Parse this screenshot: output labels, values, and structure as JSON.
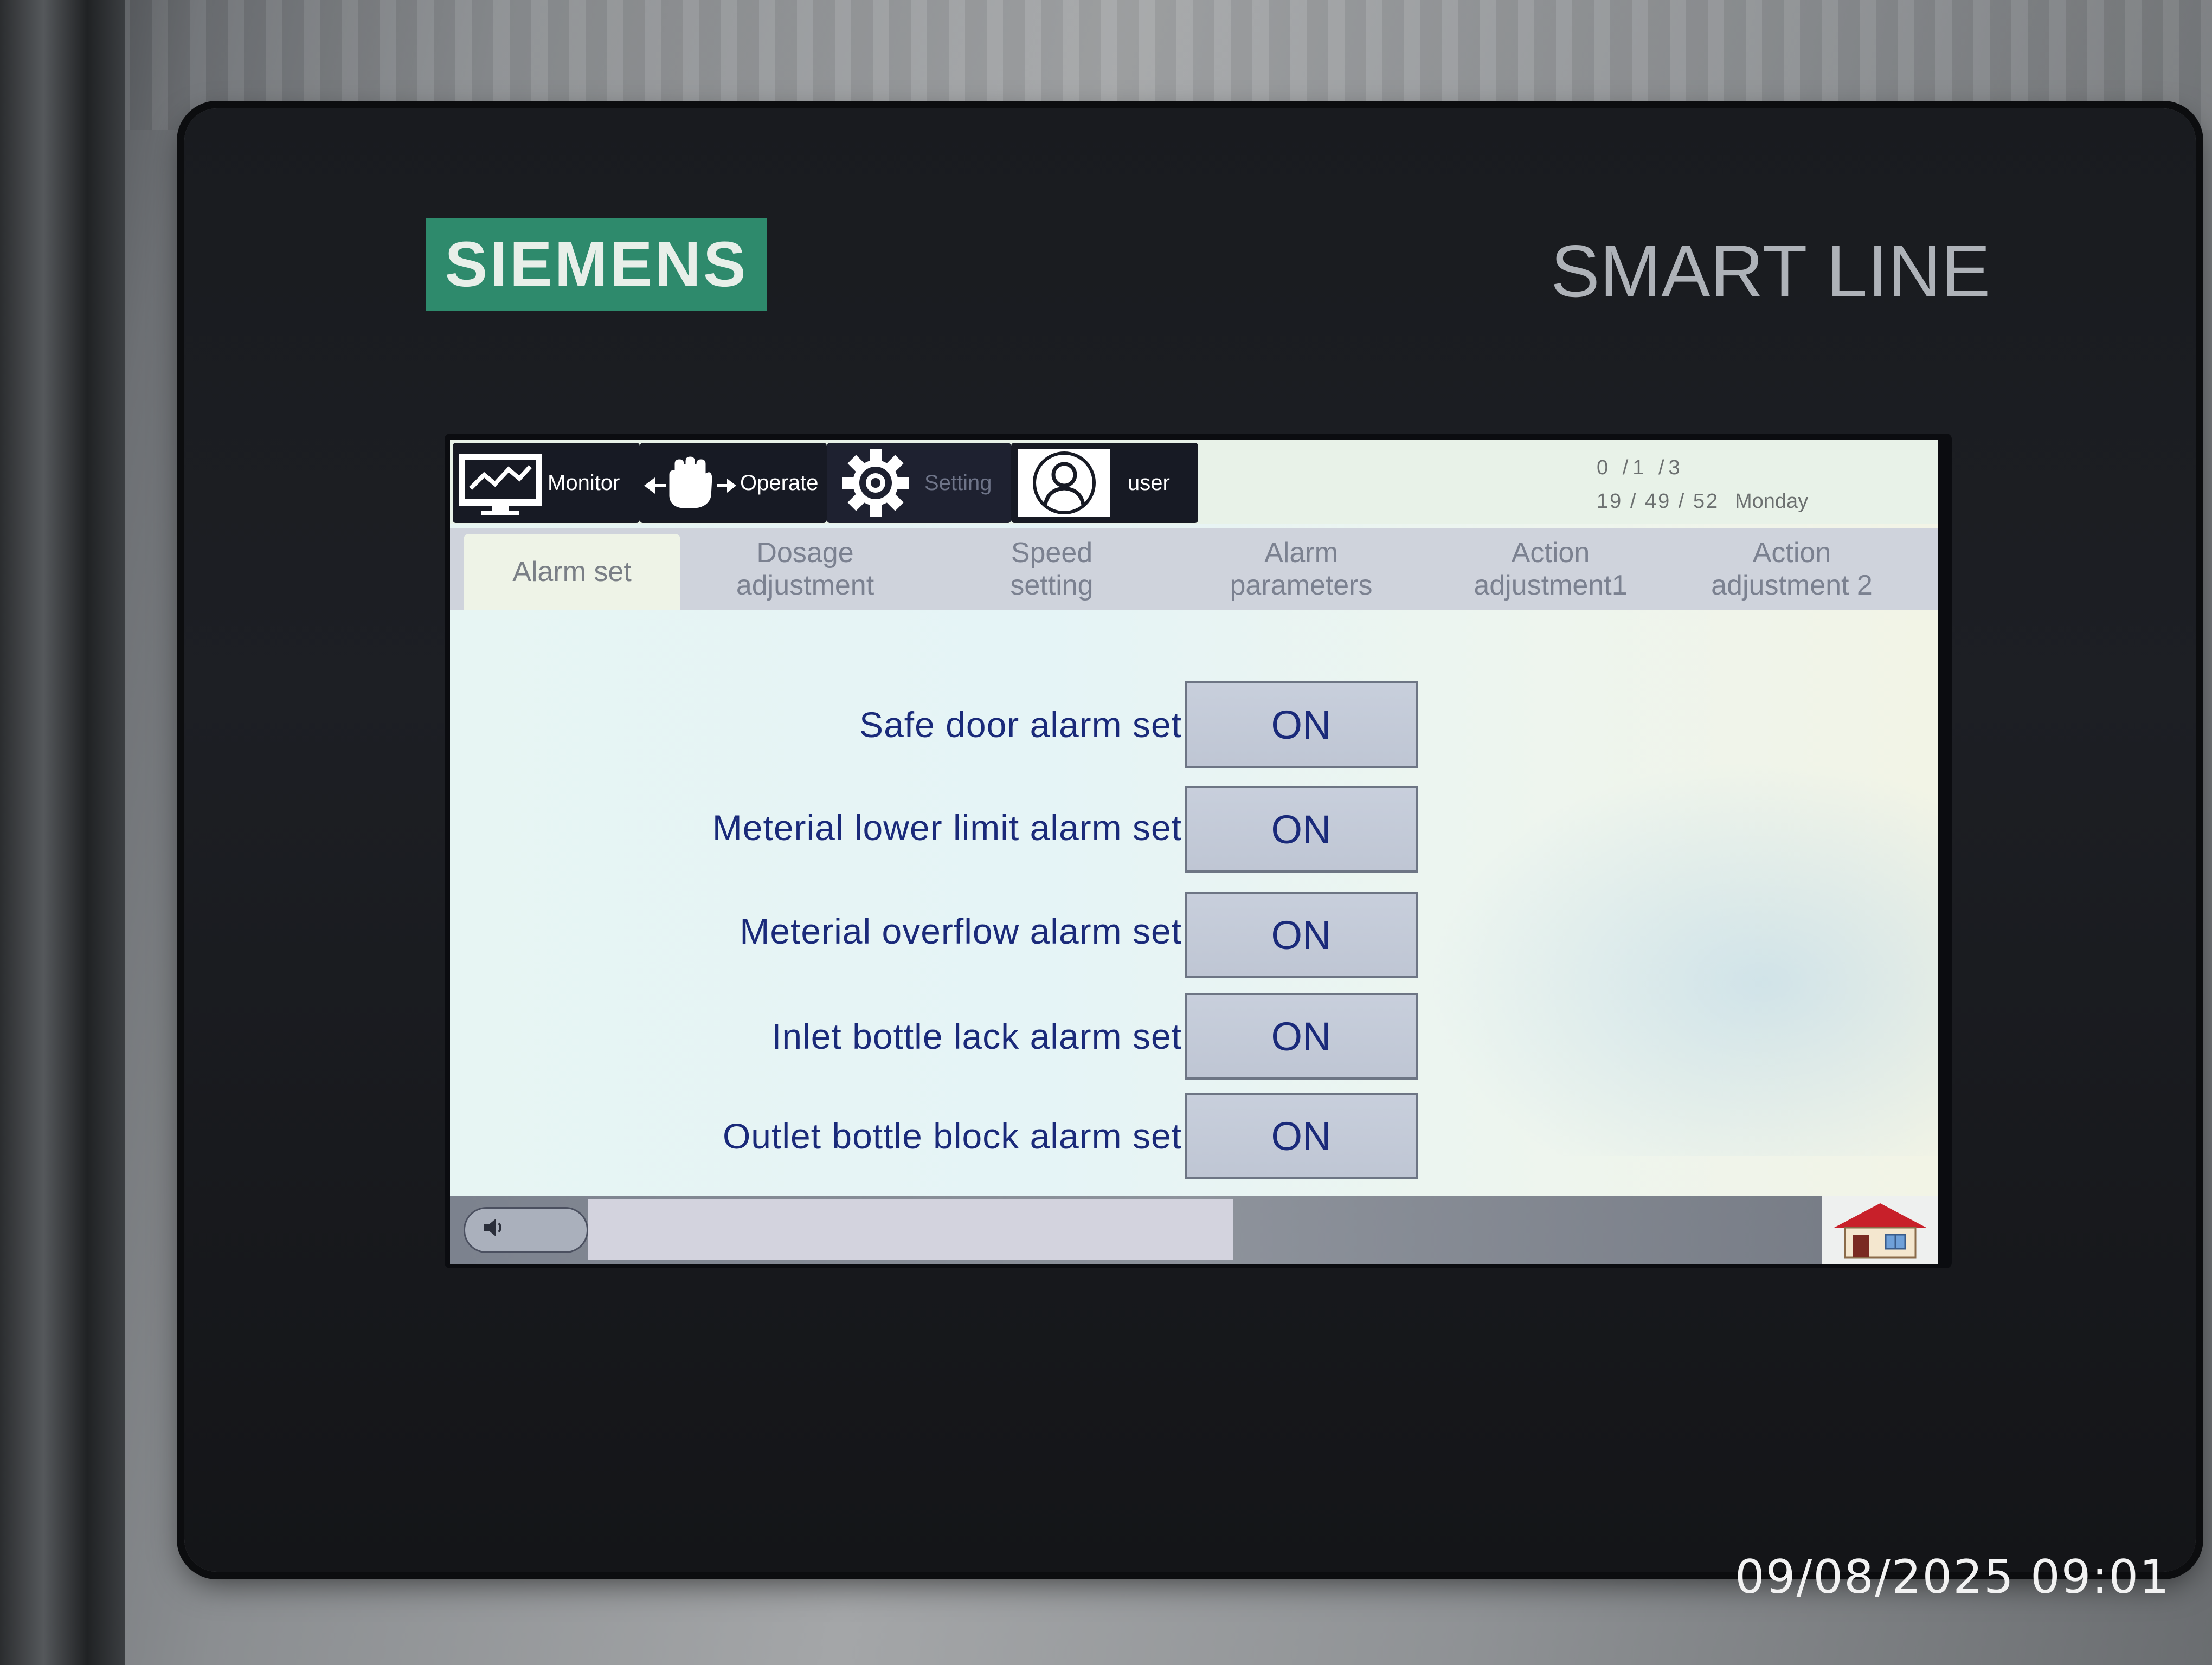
{
  "device": {
    "brand_logo": "SIEMENS",
    "series_label": "SMART LINE"
  },
  "nav": {
    "monitor": {
      "label": "Monitor",
      "icon": "trend-monitor-icon"
    },
    "operate": {
      "label": "Operate",
      "icon": "hand-operate-icon"
    },
    "setting": {
      "label": "Setting",
      "icon": "gear-icon"
    },
    "user": {
      "label": "user",
      "icon": "user-icon"
    }
  },
  "datetime": {
    "date": "0 /1 /3",
    "time": "19 / 49 / 52",
    "weekday": "Monday"
  },
  "tabs": [
    {
      "line1": "Alarm set",
      "line2": "",
      "active": true
    },
    {
      "line1": "Dosage",
      "line2": "adjustment",
      "active": false
    },
    {
      "line1": "Speed",
      "line2": "setting",
      "active": false
    },
    {
      "line1": "Alarm",
      "line2": "parameters",
      "active": false
    },
    {
      "line1": "Action",
      "line2": "adjustment1",
      "active": false
    },
    {
      "line1": "Action",
      "line2": "adjustment 2",
      "active": false
    }
  ],
  "alarms": [
    {
      "label": "Safe door alarm set",
      "state": "ON"
    },
    {
      "label": "Meterial lower limit alarm set",
      "state": "ON"
    },
    {
      "label": "Meterial overflow alarm set",
      "state": "ON"
    },
    {
      "label": "Inlet bottle lack alarm set",
      "state": "ON"
    },
    {
      "label": "Outlet bottle block alarm set",
      "state": "ON"
    }
  ],
  "bottom": {
    "speaker_icon": "speaker-icon",
    "message": "",
    "home_icon": "home-icon"
  },
  "photo_timestamp": "09/08/2025 09:01",
  "colors": {
    "label_text": "#1a2a7a",
    "button_bg": "#c4cbd8",
    "logo_green": "#2e8a6c",
    "nav_bg": "#171a24"
  }
}
